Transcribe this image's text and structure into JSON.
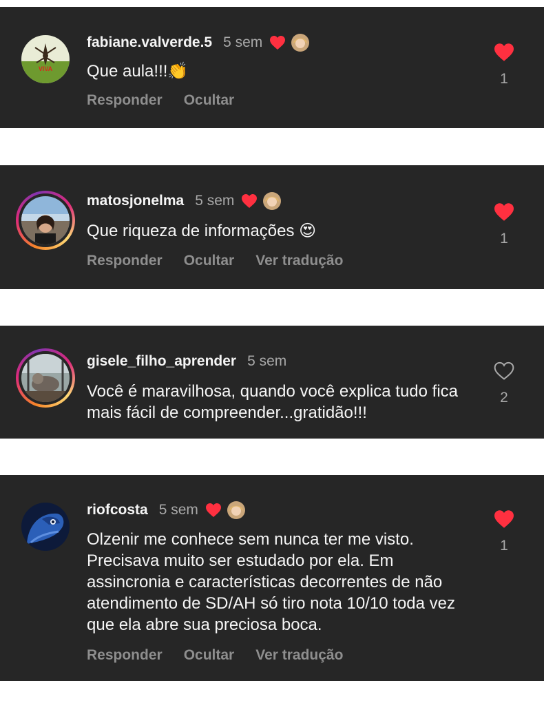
{
  "comments": [
    {
      "username": "fabiane.valverde.5",
      "time": "5 sem",
      "liked_by_creator": true,
      "text": "Que aula!!!👏",
      "actions": [
        "Responder",
        "Ocultar"
      ],
      "like_count": "1",
      "liked": true,
      "avatar_label": "VIVA"
    },
    {
      "username": "matosjonelma",
      "time": "5 sem",
      "liked_by_creator": true,
      "text": "Que riqueza de informações 😍",
      "actions": [
        "Responder",
        "Ocultar",
        "Ver tradução"
      ],
      "like_count": "1",
      "liked": true
    },
    {
      "username": "gisele_filho_aprender",
      "time": "5 sem",
      "liked_by_creator": false,
      "text": "Você é maravilhosa, quando você explica tudo fica mais fácil de compreender...gratidão!!!",
      "actions": [],
      "like_count": "2",
      "liked": false
    },
    {
      "username": "riofcosta",
      "time": "5 sem",
      "liked_by_creator": true,
      "text": "Olzenir me conhece sem nunca ter me visto. Precisava muito ser estudado por ela. Em assincronia e características decorrentes de não atendimento de SD/AH só tiro nota 10/10 toda vez que ela abre sua preciosa boca.",
      "actions": [
        "Responder",
        "Ocultar",
        "Ver tradução"
      ],
      "like_count": "1",
      "liked": true
    }
  ],
  "colors": {
    "card_bg": "#262626",
    "heart_red": "#ff3040",
    "muted_text": "#8e8e8e"
  }
}
